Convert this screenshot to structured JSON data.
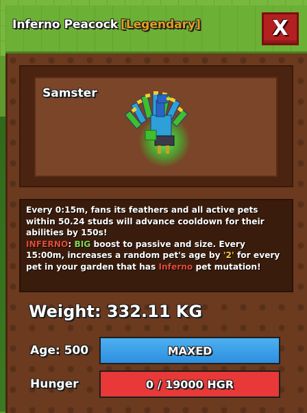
{
  "window": {
    "pet_name": "Inferno Peacock",
    "rarity": "[Legendary]",
    "close_label": "X"
  },
  "preview": {
    "owner_name": "Samster",
    "pet_icon": "peacock-icon"
  },
  "description": {
    "line1": "Every 0:15m, fans its feathers and all active pets within 50.24 studs will advance cooldown for their abilities by 150s!",
    "mutation_tag": "INFERNO",
    "colon_sep": ": ",
    "boost_word": "BIG",
    "line2a": " boost to passive and size. Every 15:00m, increases a random pet's age by ",
    "age_amount": "'2'",
    "line2b": " for every pet in your garden that has ",
    "mutation_word": "Inferno",
    "line2c": " pet mutation!"
  },
  "stats": {
    "weight_text": "Weight: 332.11 KG",
    "age_label": "Age: 500",
    "age_bar_text": "MAXED",
    "age_fraction": 1.0,
    "hunger_label": "Hunger",
    "hunger_bar_text": "0 / 19000 HGR",
    "hunger_fraction": 0.0
  },
  "colors": {
    "rarity": "#e0a020",
    "close_button": "#b32020",
    "age_bar": "#2e8fe0",
    "hunger_bar": "#e83838",
    "mutation_text": "#e04a3a",
    "boost_text": "#7ed957"
  }
}
